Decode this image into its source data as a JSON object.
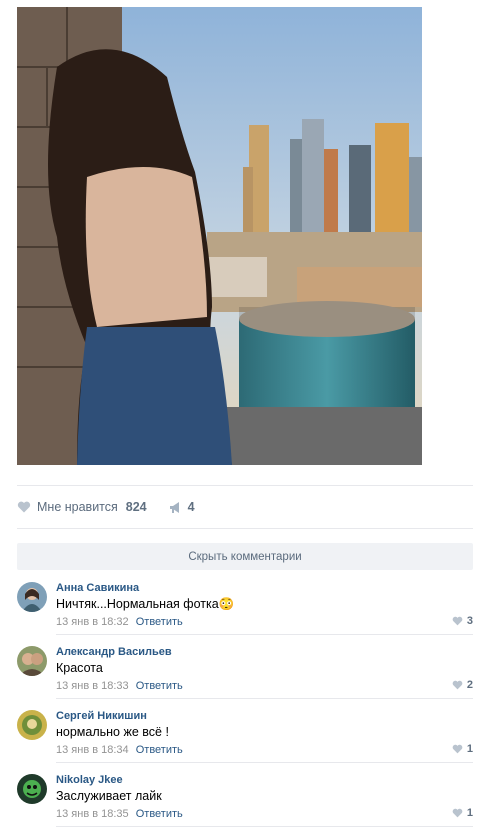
{
  "post": {
    "likes_label": "Мне нравится",
    "likes_count": "824",
    "shares_count": "4"
  },
  "comments_toggle_label": "Скрыть комментарии",
  "comments": [
    {
      "author": "Анна Савикина",
      "text": "Ничтяк...Нормальная фотка",
      "emoji": "😳",
      "date": "13 янв в 18:32",
      "reply": "Ответить",
      "likes": "3"
    },
    {
      "author": "Александр Васильев",
      "text": "Красота",
      "emoji": "",
      "date": "13 янв в 18:33",
      "reply": "Ответить",
      "likes": "2"
    },
    {
      "author": "Сергей Никишин",
      "text": "нормально же всё !",
      "emoji": "",
      "date": "13 янв в 18:34",
      "reply": "Ответить",
      "likes": "1"
    },
    {
      "author": "Nikolay Jkee",
      "text": "Заслуживает лайк",
      "emoji": "",
      "date": "13 янв в 18:35",
      "reply": "Ответить",
      "likes": "1"
    }
  ],
  "icons": {
    "like": "heart-icon",
    "share": "megaphone-icon"
  },
  "colors": {
    "link": "#2a5885",
    "meta": "#939393",
    "bar_bg": "#f0f2f5"
  }
}
